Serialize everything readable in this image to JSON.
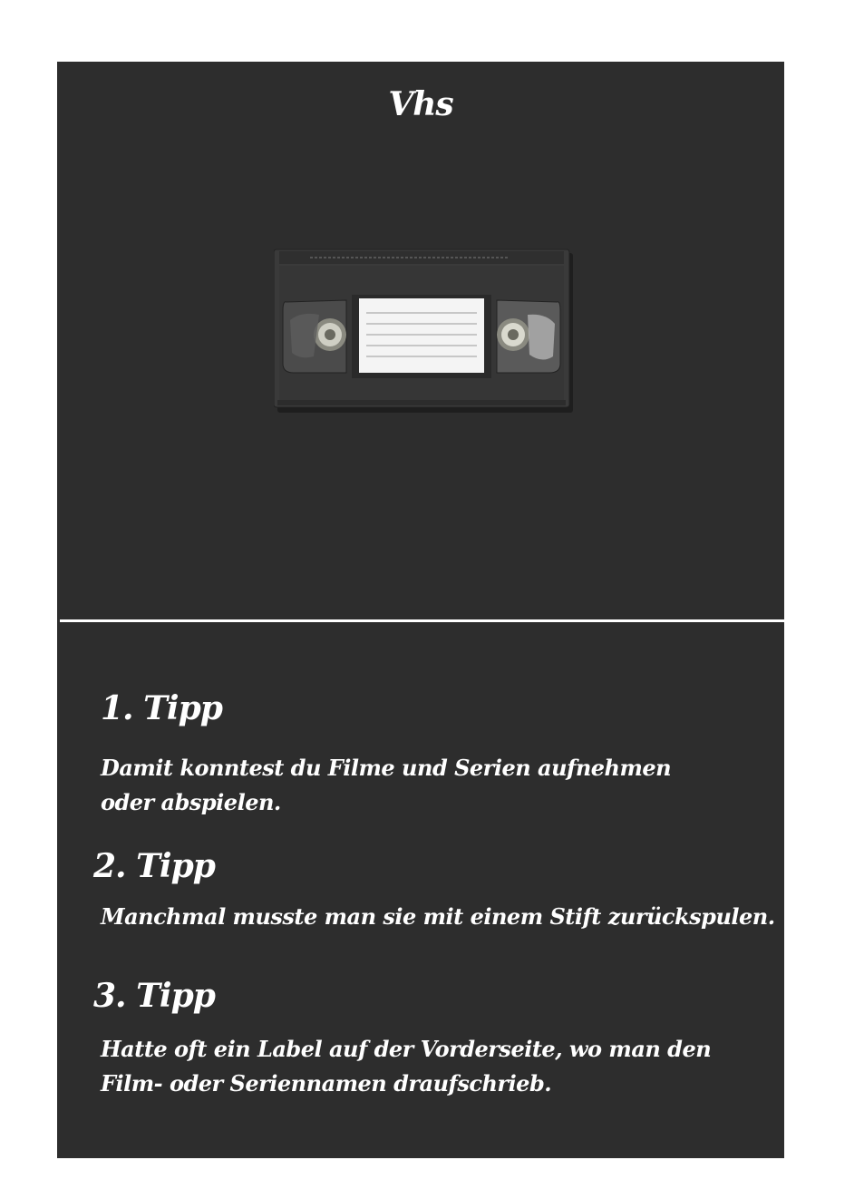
{
  "card": {
    "title": "Vhs",
    "background_color": "#2d2d2d",
    "text_color": "#ffffff"
  },
  "image": {
    "icon": "vhs-cassette-icon"
  },
  "tips": [
    {
      "heading": "1. Tipp",
      "text": "Damit konntest du Filme und Serien aufnehmen oder abspielen."
    },
    {
      "heading": "2. Tipp",
      "text": "Manchmal musste man sie mit einem Stift zurückspulen."
    },
    {
      "heading": "3. Tipp",
      "text": "Hatte oft ein Label auf der Vorderseite, wo man den Film- oder Seriennamen draufschrieb."
    }
  ]
}
